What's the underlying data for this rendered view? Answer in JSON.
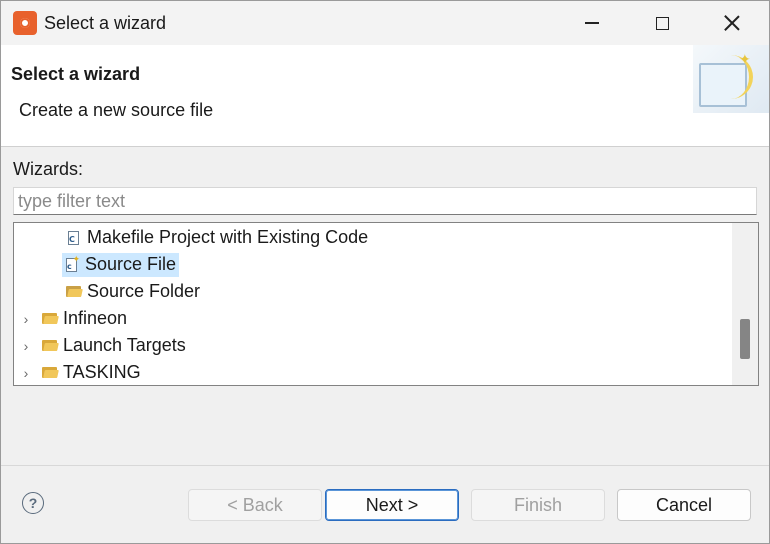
{
  "window": {
    "title": "Select a wizard"
  },
  "header": {
    "title": "Select a wizard",
    "description": "Create a new source file"
  },
  "wizards": {
    "label": "Wizards:",
    "filter_placeholder": "type filter text",
    "filter_value": ""
  },
  "tree": {
    "items": [
      {
        "label": "Makefile Project with Existing Code",
        "icon": "makefile-project-icon",
        "type": "wizard",
        "selected": false
      },
      {
        "label": "Source File",
        "icon": "source-file-icon",
        "type": "wizard",
        "selected": true
      },
      {
        "label": "Source Folder",
        "icon": "source-folder-icon",
        "type": "wizard",
        "selected": false
      },
      {
        "label": "Infineon",
        "icon": "folder-icon",
        "type": "category",
        "expanded": false
      },
      {
        "label": "Launch Targets",
        "icon": "folder-icon",
        "type": "category",
        "expanded": false
      },
      {
        "label": "TASKING",
        "icon": "folder-icon",
        "type": "category",
        "expanded": false
      }
    ]
  },
  "buttons": {
    "back": "< Back",
    "next": "Next >",
    "finish": "Finish",
    "cancel": "Cancel"
  },
  "colors": {
    "selection": "#cce8ff",
    "app_icon": "#e8612c",
    "primary_border": "#2a6cc0"
  }
}
